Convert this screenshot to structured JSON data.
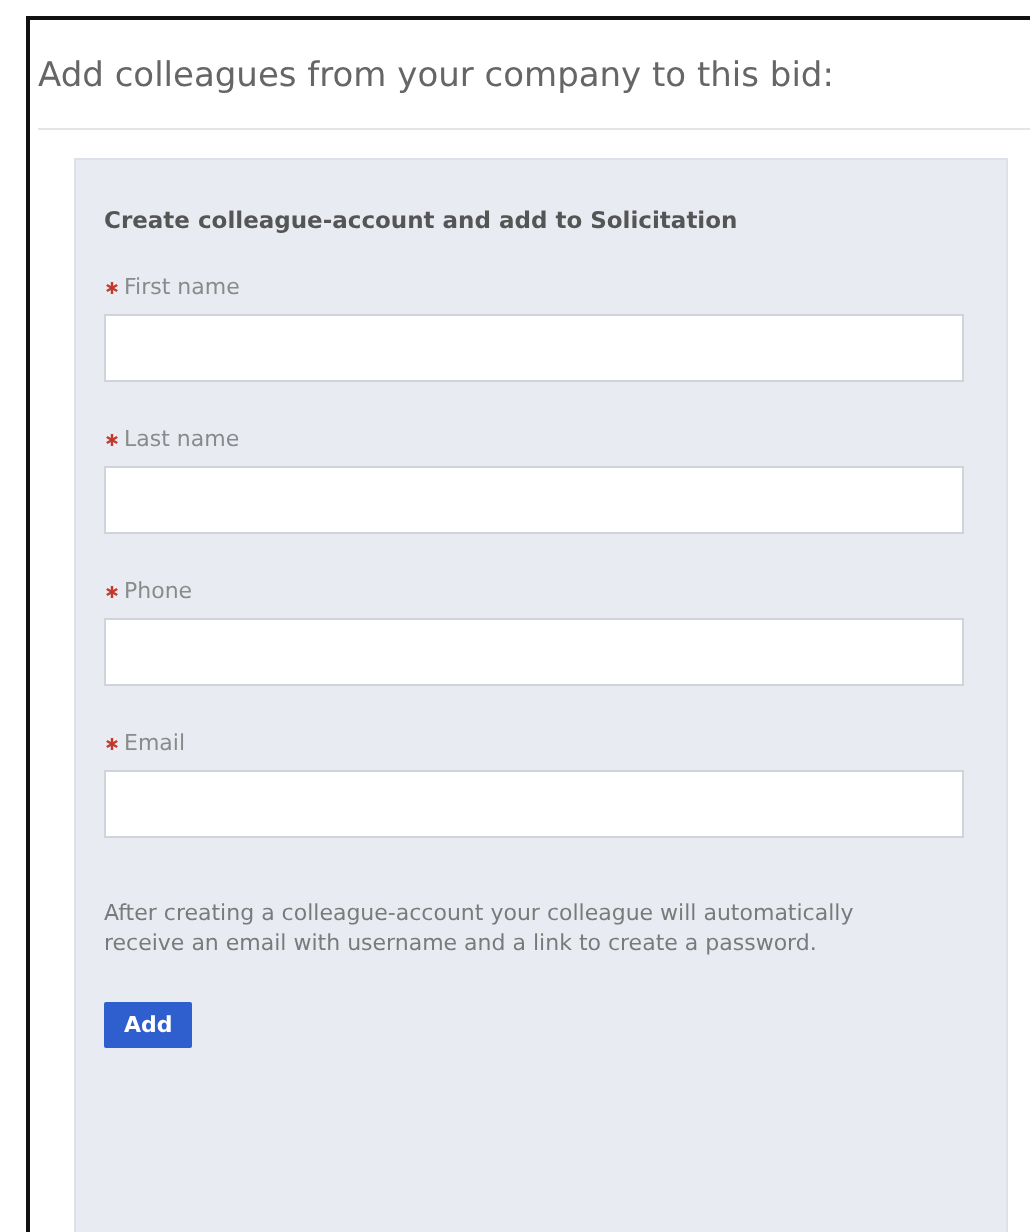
{
  "heading": "Add colleagues from your company to this bid:",
  "panel": {
    "title": "Create colleague-account and add to Solicitation",
    "fields": [
      {
        "label": "First name",
        "required": true
      },
      {
        "label": "Last name",
        "required": true
      },
      {
        "label": "Phone",
        "required": true
      },
      {
        "label": "Email",
        "required": true
      }
    ],
    "note": "After creating a colleague-account your colleague will automatically receive an email with username and a link to create a password.",
    "button": "Add"
  }
}
